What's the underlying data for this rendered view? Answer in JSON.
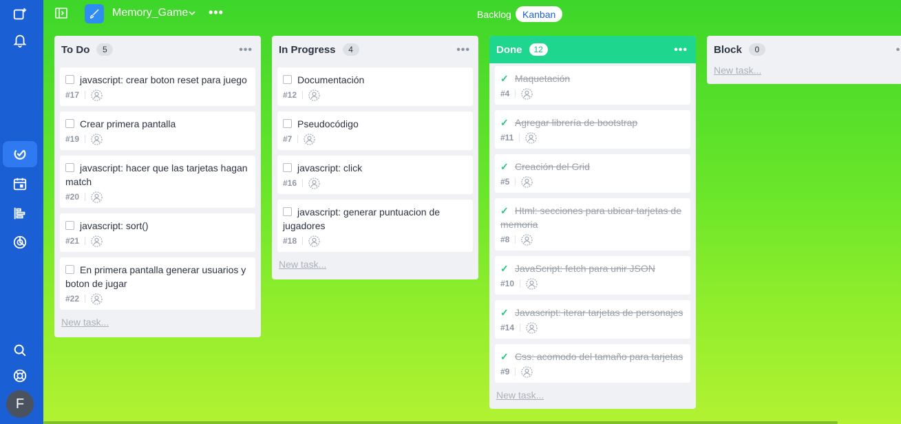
{
  "app": {
    "project_name": "Memory_Game"
  },
  "views": {
    "backlog": "Backlog",
    "kanban": "Kanban"
  },
  "user": {
    "initial": "F"
  },
  "columns": [
    {
      "title": "To Do",
      "count": "5",
      "new_task": "New task...",
      "cards": [
        {
          "title": "javascript: crear boton reset para juego",
          "num": "#17"
        },
        {
          "title": "Crear primera pantalla",
          "num": "#19"
        },
        {
          "title": "javascript: hacer que las tarjetas hagan match",
          "num": "#20"
        },
        {
          "title": "javascript: sort()",
          "num": "#21"
        },
        {
          "title": "En primera pantalla generar usuarios y boton de jugar",
          "num": "#22"
        }
      ]
    },
    {
      "title": "In Progress",
      "count": "4",
      "new_task": "New task...",
      "cards": [
        {
          "title": "Documentación",
          "num": "#12"
        },
        {
          "title": "Pseudocódigo",
          "num": "#7"
        },
        {
          "title": "javascript: click",
          "num": "#16"
        },
        {
          "title": "javascript: generar puntuacion de jugadores",
          "num": "#18"
        }
      ]
    },
    {
      "title": "Done",
      "count": "12",
      "new_task": "New task...",
      "cards": [
        {
          "title": "Maquetación",
          "num": "#4"
        },
        {
          "title": "Agregar librería de bootstrap",
          "num": "#11"
        },
        {
          "title": "Creación del Grid",
          "num": "#5"
        },
        {
          "title": "Html: secciones para ubicar tarjetas de memoria",
          "num": "#8"
        },
        {
          "title": "JavaScript: fetch para unir  JSON",
          "num": "#10"
        },
        {
          "title": "Javascript: iterar tarjetas de personajes",
          "num": "#14"
        },
        {
          "title": "Css: acomodo del tamaño para tarjetas",
          "num": "#9"
        }
      ]
    },
    {
      "title": "Block",
      "count": "0",
      "new_task": "New task...",
      "cards": []
    }
  ]
}
